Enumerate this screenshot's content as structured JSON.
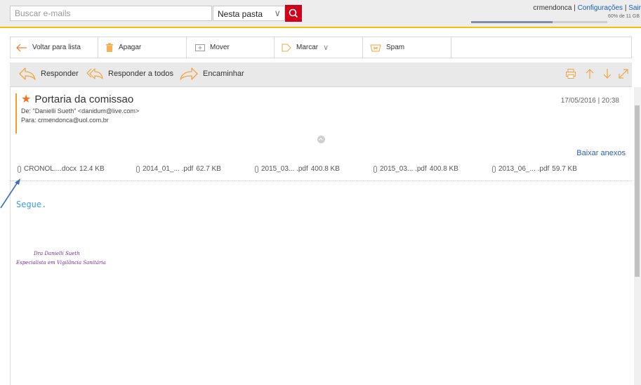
{
  "search": {
    "placeholder": "Buscar e-mails",
    "scope": "Nesta pasta"
  },
  "account": {
    "user": "crmendonca",
    "settings": "Configurações",
    "logout": "Sair",
    "separator": " | ",
    "quota_text": "60% de 11 GB",
    "quota_fraction": 0.6
  },
  "actions": {
    "back": "Voltar para lista",
    "delete": "Apagar",
    "move": "Mover",
    "mark": "Marcar",
    "spam": "Spam"
  },
  "message_toolbar": {
    "reply": "Responder",
    "reply_all": "Responder a todos",
    "forward": "Encaminhar"
  },
  "message": {
    "subject": "Portaria da comissao",
    "from": "De: \"Danielli Sueth\" <danidum@live.com>",
    "to": "Para: crmendonca@uol.com.br",
    "date": "17/05/2016 | 20:38",
    "download_all": "Baixar anexos",
    "attachments": [
      {
        "name": "CRONOL....docx",
        "size": "12.4 KB"
      },
      {
        "name": "2014_01_... .pdf",
        "size": "62.7 KB"
      },
      {
        "name": "2015_03... .pdf",
        "size": "400.8 KB"
      },
      {
        "name": "2015_03... .pdf",
        "size": "400.8 KB"
      },
      {
        "name": "2013_06_... .pdf",
        "size": "59.7 KB"
      }
    ],
    "body": "Segue.",
    "signature": {
      "name": "Dra Danielli Sueth",
      "title": "Especialista em Vigilância Sanitária"
    }
  },
  "colors": {
    "accent_yellow": "#f2c200",
    "brand_red": "#d0021b",
    "star_orange": "#f0731a",
    "link_blue": "#2a5fb0",
    "signature_purple": "#7a2a92"
  },
  "icons": [
    "search-icon",
    "back-arrow-icon",
    "trash-icon",
    "folder-move-icon",
    "tag-icon",
    "spam-icon",
    "reply-icon",
    "reply-all-icon",
    "forward-icon",
    "print-icon",
    "arrow-up-icon",
    "arrow-down-icon",
    "expand-icon",
    "star-icon",
    "paperclip-icon",
    "collapse-icon"
  ]
}
